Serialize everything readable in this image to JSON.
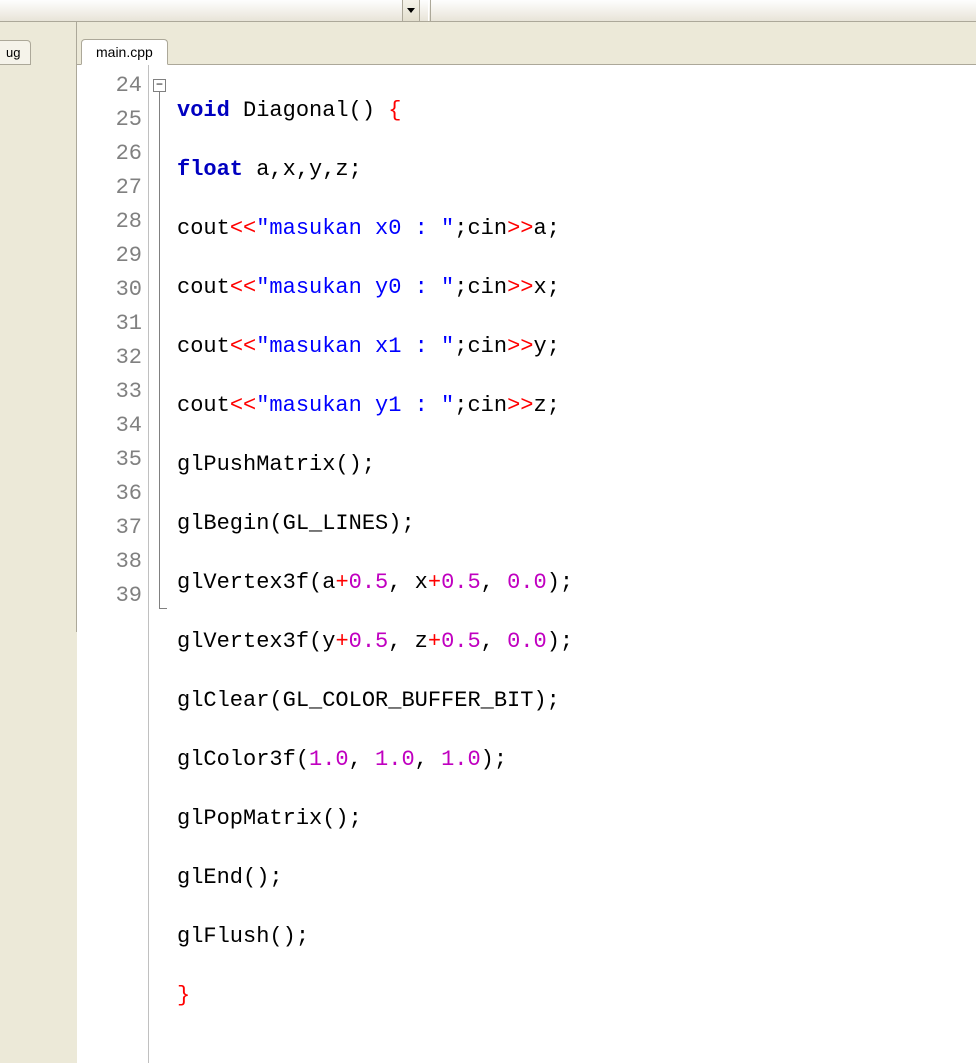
{
  "left_tab": "ug",
  "file_tab": "main.cpp",
  "line_numbers": [
    "24",
    "25",
    "26",
    "27",
    "28",
    "29",
    "30",
    "31",
    "32",
    "33",
    "34",
    "35",
    "36",
    "37",
    "38",
    "39"
  ],
  "fold_symbol": "−",
  "code": {
    "l24": {
      "kw1": "void",
      "name": "Diagonal",
      "paren": "()",
      "brace": "{"
    },
    "l25": {
      "kw1": "float",
      "vars": "a,x,y,z",
      "semi": ";"
    },
    "l26": {
      "cout": "cout",
      "op1": "<<",
      "str": "\"masukan x0 : \"",
      "semi1": ";",
      "cin": "cin",
      "op2": ">>",
      "var": "a",
      "semi2": ";"
    },
    "l27": {
      "cout": "cout",
      "op1": "<<",
      "str": "\"masukan y0 : \"",
      "semi1": ";",
      "cin": "cin",
      "op2": ">>",
      "var": "x",
      "semi2": ";"
    },
    "l28": {
      "cout": "cout",
      "op1": "<<",
      "str": "\"masukan x1 : \"",
      "semi1": ";",
      "cin": "cin",
      "op2": ">>",
      "var": "y",
      "semi2": ";"
    },
    "l29": {
      "cout": "cout",
      "op1": "<<",
      "str": "\"masukan y1 : \"",
      "semi1": ";",
      "cin": "cin",
      "op2": ">>",
      "var": "z",
      "semi2": ";"
    },
    "l30": {
      "fn": "glPushMatrix",
      "paren": "()",
      "semi": ";"
    },
    "l31": {
      "fn": "glBegin",
      "po": "(",
      "arg": "GL_LINES",
      "pc": ")",
      "semi": ";"
    },
    "l32": {
      "fn": "glVertex3f",
      "po": "(",
      "a1": "a",
      "plus1": "+",
      "n1": "0.5",
      "c1": ", ",
      "a2": "x",
      "plus2": "+",
      "n2": "0.5",
      "c2": ", ",
      "n3": "0.0",
      "pc": ")",
      "semi": ";"
    },
    "l33": {
      "fn": "glVertex3f",
      "po": "(",
      "a1": "y",
      "plus1": "+",
      "n1": "0.5",
      "c1": ", ",
      "a2": "z",
      "plus2": "+",
      "n2": "0.5",
      "c2": ", ",
      "n3": "0.0",
      "pc": ")",
      "semi": ";"
    },
    "l34": {
      "fn": "glClear",
      "po": "(",
      "arg": "GL_COLOR_BUFFER_BIT",
      "pc": ")",
      "semi": ";"
    },
    "l35": {
      "fn": "glColor3f",
      "po": "(",
      "n1": "1.0",
      "c1": ", ",
      "n2": "1.0",
      "c2": ", ",
      "n3": "1.0",
      "pc": ")",
      "semi": ";"
    },
    "l36": {
      "fn": "glPopMatrix",
      "paren": "()",
      "semi": ";"
    },
    "l37": {
      "fn": "glEnd",
      "paren": "()",
      "semi": ";"
    },
    "l38": {
      "fn": "glFlush",
      "paren": "()",
      "semi": ";"
    },
    "l39": {
      "brace": "}"
    }
  }
}
